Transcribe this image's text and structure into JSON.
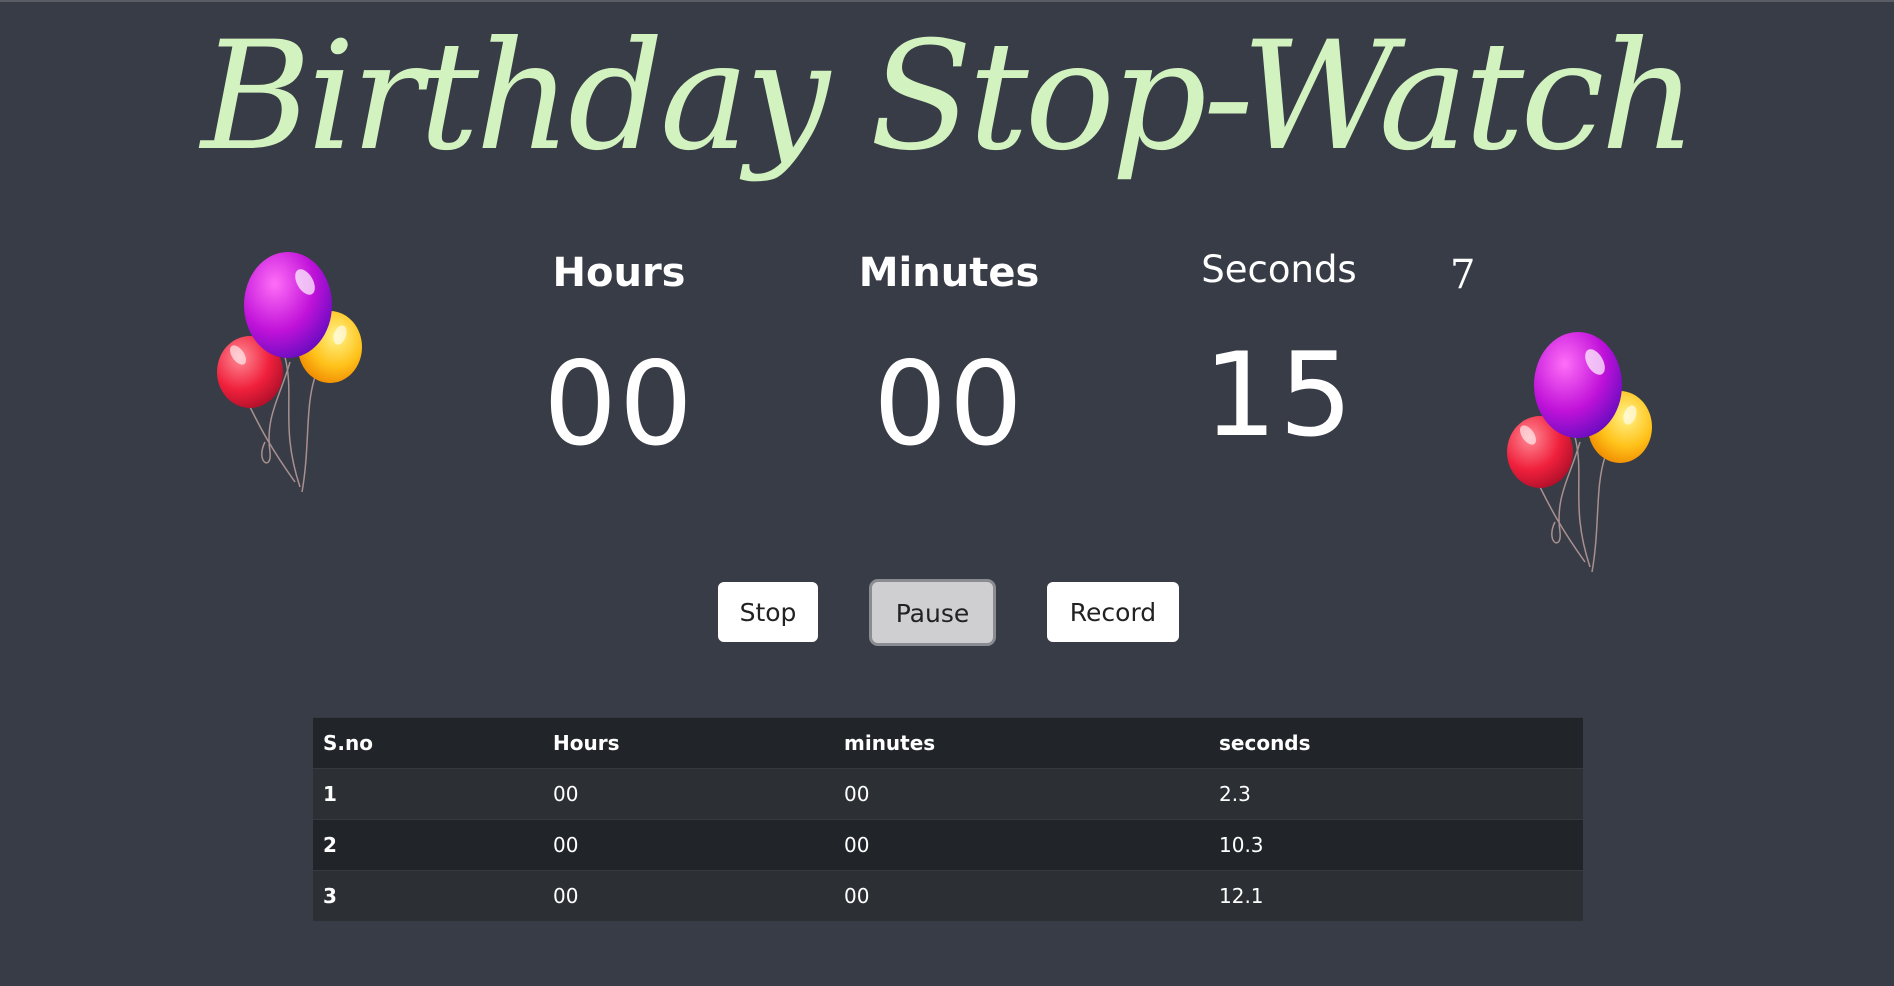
{
  "title": "Birthday Stop-Watch",
  "timer": {
    "hours_label": "Hours",
    "hours_value": "00",
    "minutes_label": "Minutes",
    "minutes_value": "00",
    "seconds_label": "Seconds",
    "seconds_value": "15",
    "extra_count": "7"
  },
  "buttons": {
    "stop": "Stop",
    "pause": "Pause",
    "record": "Record"
  },
  "table": {
    "headers": [
      "S.no",
      "Hours",
      "minutes",
      "seconds"
    ],
    "rows": [
      [
        "1",
        "00",
        "00",
        "2.3"
      ],
      [
        "2",
        "00",
        "00",
        "10.3"
      ],
      [
        "3",
        "00",
        "00",
        "12.1"
      ]
    ]
  },
  "colors": {
    "background": "#383c46",
    "title": "#d2f2c0",
    "table_dark": "#212529",
    "table_light": "#2c3034"
  },
  "icons": {
    "balloons_left": "balloons-icon",
    "balloons_right": "balloons-icon"
  }
}
